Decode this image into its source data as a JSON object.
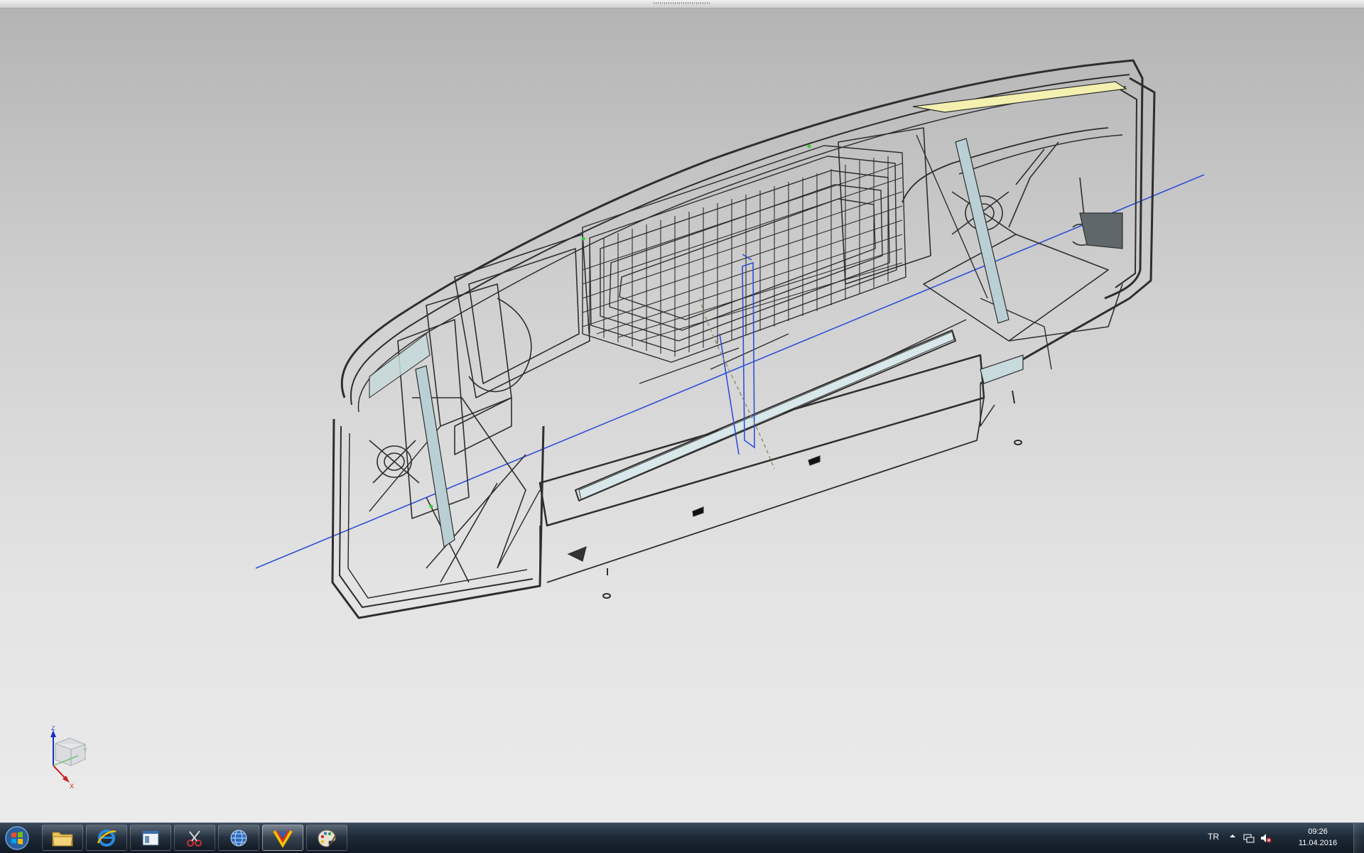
{
  "viewport": {
    "triad_axes": {
      "z": "Z",
      "y": "Y",
      "x": "X"
    }
  },
  "taskbar": {
    "pinned": [
      {
        "name": "windows-explorer",
        "icon": "folder-icon"
      },
      {
        "name": "internet-explorer",
        "icon": "ie-icon"
      },
      {
        "name": "window-app",
        "icon": "window-icon"
      },
      {
        "name": "snipping-tool",
        "icon": "scissors-icon"
      },
      {
        "name": "globe-app",
        "icon": "globe-icon"
      },
      {
        "name": "cad-app",
        "icon": "cad-logo-icon",
        "active": true
      },
      {
        "name": "paint-app",
        "icon": "paint-palette-icon"
      }
    ],
    "tray": {
      "language": "TR",
      "time": "09:26",
      "date": "11.04.2016"
    }
  },
  "colors": {
    "wireframe": "#2e2e2e",
    "axis_line": "#2f4fd8",
    "highlight_yellow": "#f4f0b0",
    "panel_fill": "#b9d1d6",
    "taskbar": "#1d2a38"
  }
}
